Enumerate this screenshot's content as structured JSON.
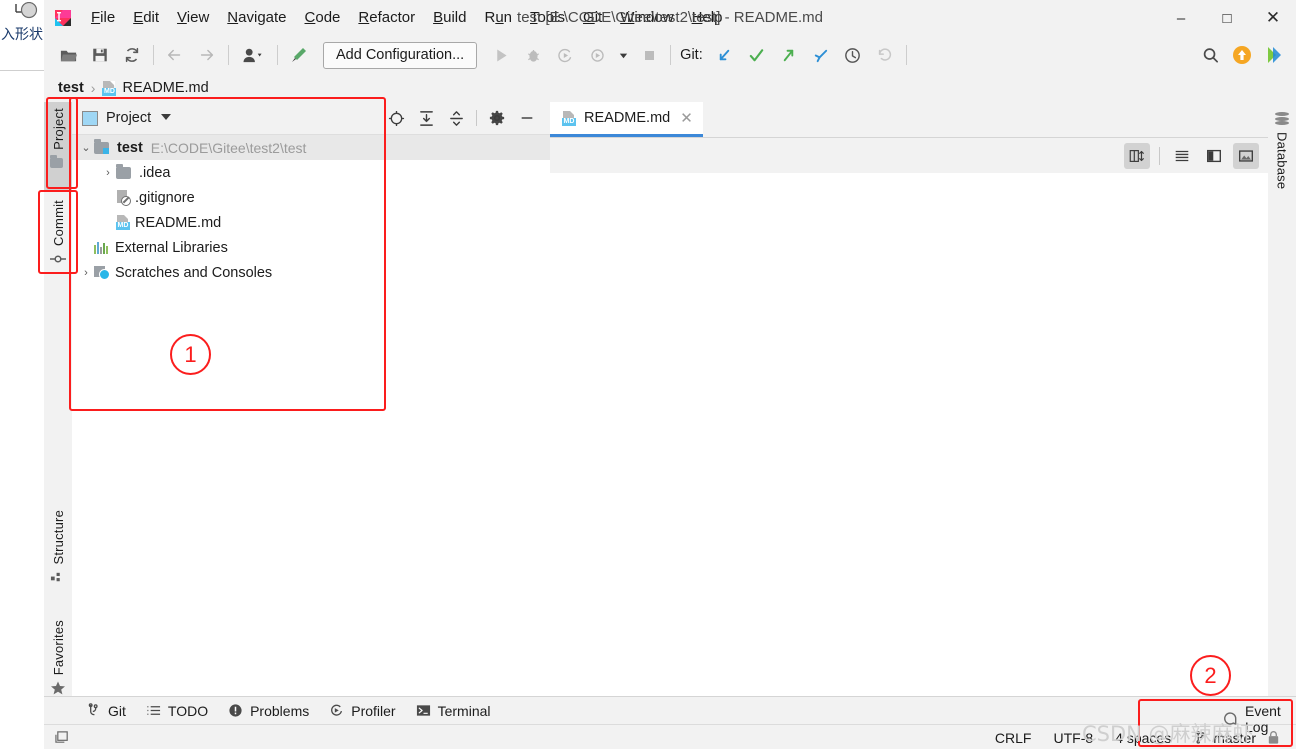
{
  "outside": {
    "cn_text": "入形状"
  },
  "window": {
    "title": "test [E:\\CODE\\Gitee\\test2\\test] - README.md",
    "minimize": "–",
    "maximize": "□",
    "close": "✕"
  },
  "menu": {
    "items": [
      {
        "label": "File",
        "accel": "F"
      },
      {
        "label": "Edit",
        "accel": "E"
      },
      {
        "label": "View",
        "accel": "V"
      },
      {
        "label": "Navigate",
        "accel": "N"
      },
      {
        "label": "Code",
        "accel": "C"
      },
      {
        "label": "Refactor",
        "accel": "R"
      },
      {
        "label": "Build",
        "accel": "B"
      },
      {
        "label": "Run",
        "accel": "u"
      },
      {
        "label": "Tools",
        "accel": "T"
      },
      {
        "label": "Git",
        "accel": "G"
      },
      {
        "label": "Window",
        "accel": "W"
      },
      {
        "label": "Help",
        "accel": "H"
      }
    ]
  },
  "toolbar": {
    "open_icon": "open-folder-icon",
    "save_icon": "save-icon",
    "sync_icon": "sync-icon",
    "back_icon": "back-arrow-icon",
    "forward_icon": "forward-arrow-icon",
    "profile_icon": "user-profile-icon",
    "build_icon": "build-hammer-icon",
    "run_config": "Add Configuration...",
    "run_icon": "run-icon",
    "debug_icon": "debug-icon",
    "coverage_icon": "run-with-coverage-icon",
    "profile_run_icon": "profile-icon",
    "stop_icon": "stop-icon",
    "git_label": "Git:",
    "git_update_icon": "git-update-icon",
    "git_commit_icon": "git-commit-check-icon",
    "git_push_icon": "git-push-icon",
    "git_pull_icon": "git-pull-icon",
    "git_history_icon": "git-history-clock-icon",
    "git_rollback_icon": "git-rollback-icon",
    "search_icon": "search-icon",
    "update_icon": "update-available-icon",
    "share_icon": "ide-share-icon"
  },
  "breadcrumb": {
    "project": "test",
    "separator": "›",
    "file": "README.md",
    "file_icon": "markdown-file-icon"
  },
  "left_stripe": {
    "buttons": [
      {
        "label": "Project",
        "icon": "project-folder-icon",
        "active": true
      },
      {
        "label": "Commit",
        "icon": "commit-icon",
        "active": false
      },
      {
        "label": "Structure",
        "icon": "structure-icon",
        "active": false
      },
      {
        "label": "Favorites",
        "icon": "favorites-star-icon",
        "active": false
      }
    ]
  },
  "right_stripe": {
    "buttons": [
      {
        "label": "Database",
        "icon": "database-icon"
      }
    ]
  },
  "project_panel": {
    "title": "Project",
    "caret": "▼",
    "actions": [
      {
        "name": "select-opened-file-icon",
        "label": "Select Opened File"
      },
      {
        "name": "expand-all-icon",
        "label": "Expand All"
      },
      {
        "name": "collapse-all-icon",
        "label": "Collapse All"
      },
      {
        "name": "settings-gear-icon",
        "label": "Settings"
      },
      {
        "name": "hide-panel-icon",
        "label": "Hide"
      }
    ],
    "tree": [
      {
        "label": "test",
        "path": "E:\\CODE\\Gitee\\test2\\test",
        "icon": "project-folder-icon",
        "arrow": "v",
        "bold": true,
        "indent": 0,
        "selected": true
      },
      {
        "label": ".idea",
        "path": "",
        "icon": "folder-icon",
        "arrow": ">",
        "bold": false,
        "indent": 1,
        "selected": false
      },
      {
        "label": ".gitignore",
        "path": "",
        "icon": "gitignore-file-icon",
        "arrow": "",
        "bold": false,
        "indent": 1,
        "selected": false
      },
      {
        "label": "README.md",
        "path": "",
        "icon": "markdown-file-icon",
        "arrow": "",
        "bold": false,
        "indent": 1,
        "selected": false
      },
      {
        "label": "External Libraries",
        "path": "",
        "icon": "external-libraries-icon",
        "arrow": "",
        "bold": false,
        "indent": 0,
        "selected": false
      },
      {
        "label": "Scratches and Consoles",
        "path": "",
        "icon": "scratches-icon",
        "arrow": ">",
        "bold": false,
        "indent": 0,
        "selected": false
      }
    ]
  },
  "editor": {
    "tab": {
      "label": "README.md",
      "icon": "markdown-file-icon",
      "close": "✕"
    },
    "toolbar_buttons": [
      {
        "name": "split-editor-preview-icon",
        "active": true
      },
      {
        "name": "show-editor-only-icon",
        "active": false
      },
      {
        "name": "show-editor-and-preview-icon",
        "active": false
      },
      {
        "name": "show-preview-only-icon",
        "active": true
      }
    ]
  },
  "bottom_stripe": {
    "buttons": [
      {
        "label": "Git",
        "icon": "git-branch-icon"
      },
      {
        "label": "TODO",
        "icon": "todo-list-icon"
      },
      {
        "label": "Problems",
        "icon": "problems-warning-icon"
      },
      {
        "label": "Profiler",
        "icon": "profiler-icon"
      },
      {
        "label": "Terminal",
        "icon": "terminal-icon"
      }
    ],
    "event_log": {
      "label": "Event Log",
      "icon": "event-log-icon"
    }
  },
  "status_bar": {
    "left_icon": "toggle-toolwindow-icon",
    "line_separator": "CRLF",
    "encoding": "UTF-8",
    "indent": "4 spaces",
    "branch": "master",
    "branch_icon": "git-branch-icon",
    "lock_icon": "read-only-lock-icon"
  },
  "annotations": {
    "marker_1": "1",
    "marker_2": "2",
    "accent_color": "#fb1d1d",
    "watermark": "CSDN @麻辣麻虾"
  }
}
